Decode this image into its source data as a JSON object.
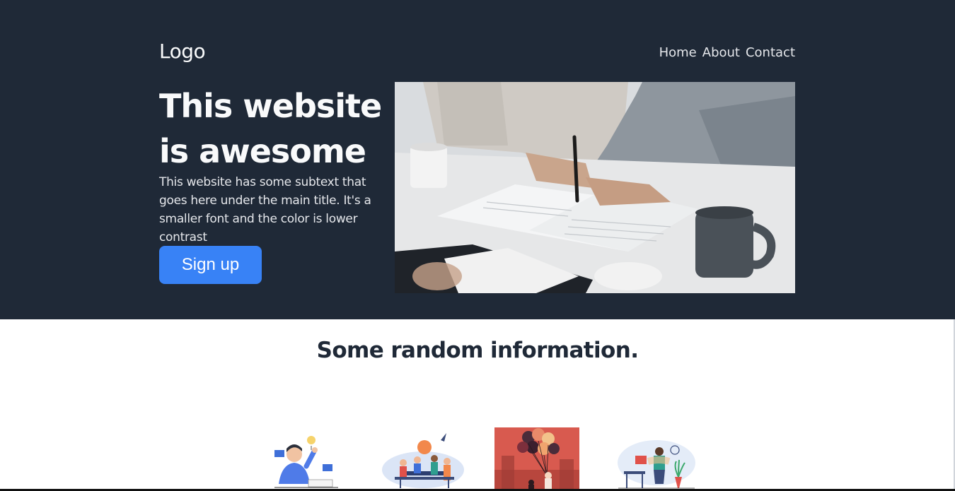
{
  "header": {
    "logo": "Logo",
    "nav": [
      "Home",
      "About",
      "Contact"
    ]
  },
  "hero": {
    "title": "This website is awesome",
    "subtext": "This website has some subtext that goes here under the main title. It's a smaller font and the color is lower contrast",
    "cta_label": "Sign up",
    "image": "photo of people signing documents at a table"
  },
  "info": {
    "title": "Some random information."
  },
  "colors": {
    "hero_bg": "#1f2937",
    "cta": "#3882f6",
    "heading_dark": "#1f2937"
  }
}
